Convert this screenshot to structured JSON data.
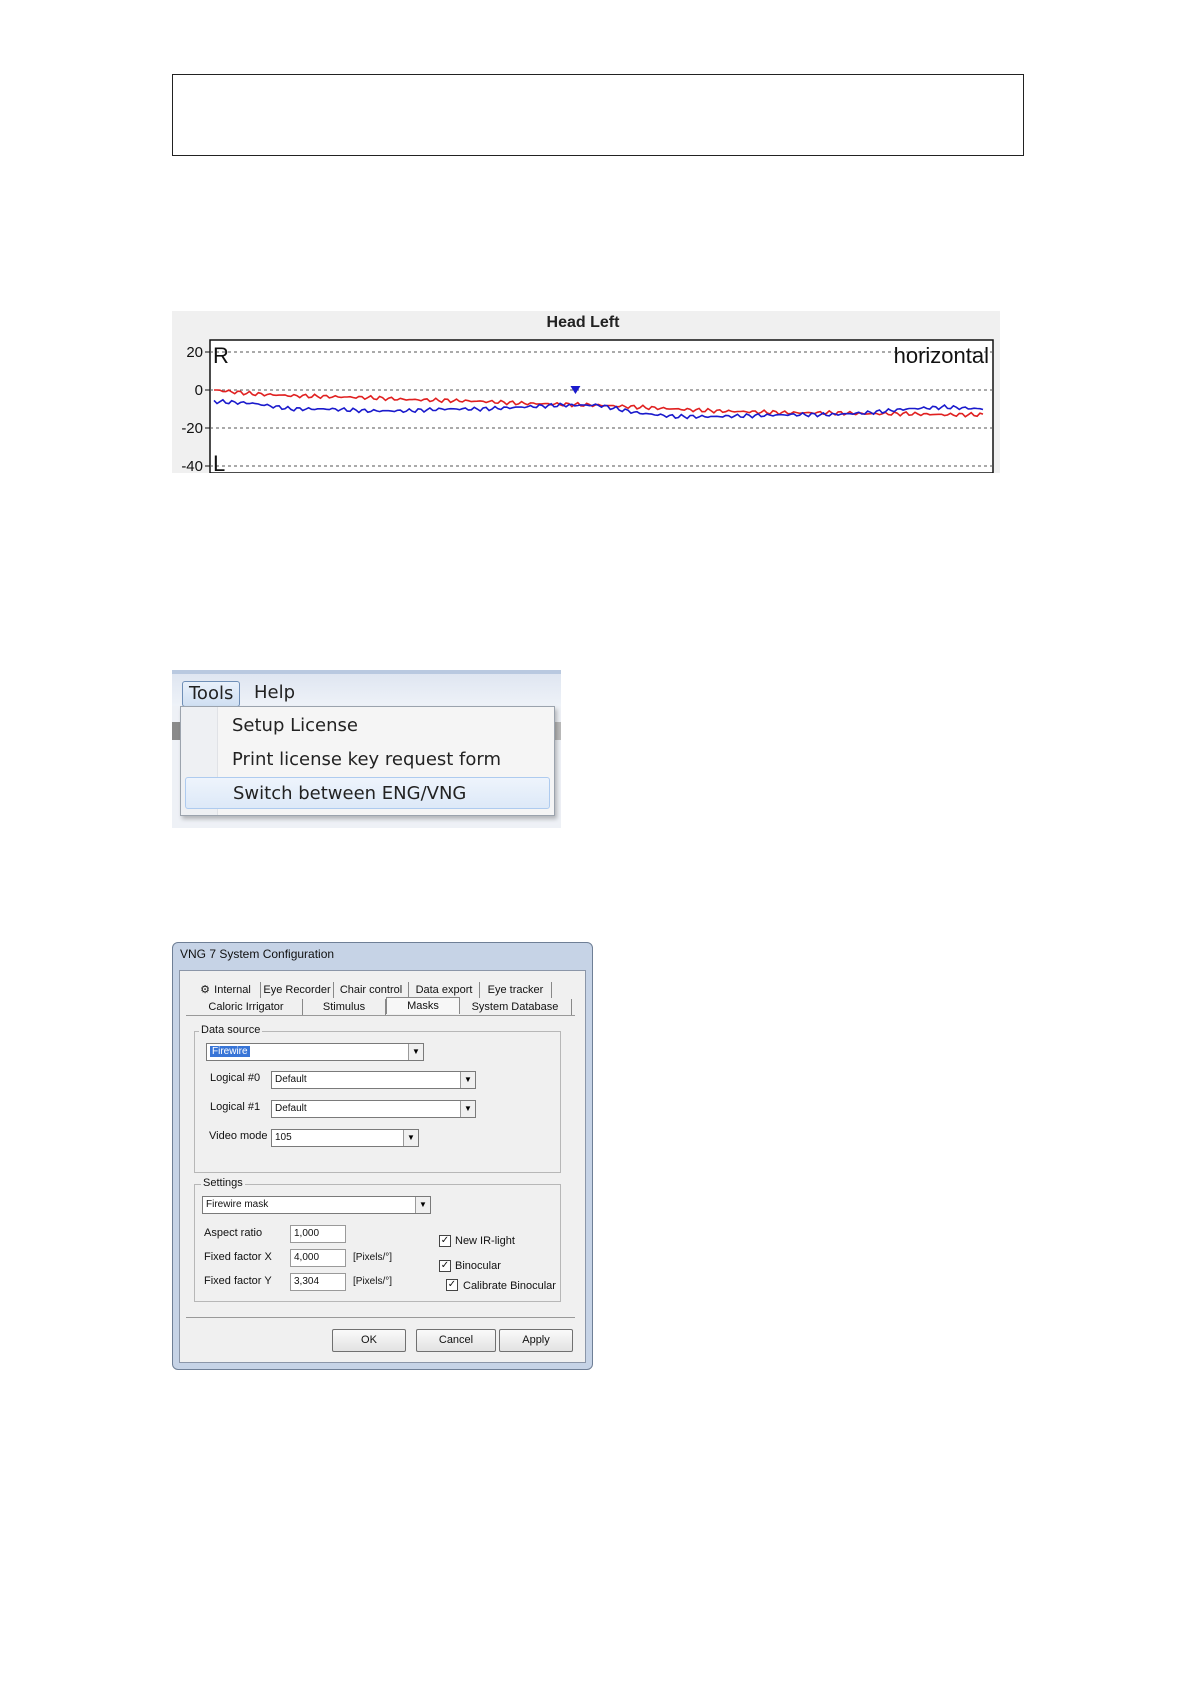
{
  "chart_data": {
    "type": "line",
    "title": "Head Left",
    "corner_labels": {
      "top_left": "R",
      "bottom_left": "L",
      "top_right": "horizontal"
    },
    "ylim": [
      -40,
      20
    ],
    "yticks": [
      "20",
      "0",
      "-20",
      "-40"
    ],
    "grid": "dashed horizontal lines at ticks",
    "xlabel": "",
    "ylabel": "",
    "marker": {
      "x": 0.47,
      "y": 0,
      "shape": "triangle-down",
      "color": "#1a1acc"
    },
    "series": [
      {
        "color": "#e02020",
        "x": [
          0,
          0.05,
          0.1,
          0.15,
          0.2,
          0.25,
          0.3,
          0.35,
          0.4,
          0.45,
          0.5,
          0.55,
          0.6,
          0.65,
          0.7,
          0.75,
          0.8,
          0.85,
          0.9,
          0.95,
          1.0
        ],
        "values": [
          0,
          -2,
          -3,
          -3.5,
          -4,
          -5,
          -5.5,
          -6,
          -7,
          -7.5,
          -8,
          -9,
          -10,
          -11,
          -11.5,
          -12,
          -12,
          -12.5,
          -12.5,
          -13,
          -13
        ]
      },
      {
        "color": "#1a1acc",
        "x": [
          0,
          0.05,
          0.1,
          0.15,
          0.2,
          0.25,
          0.3,
          0.35,
          0.4,
          0.45,
          0.5,
          0.55,
          0.6,
          0.65,
          0.7,
          0.75,
          0.8,
          0.85,
          0.9,
          0.95,
          1.0
        ],
        "values": [
          -6,
          -7,
          -10,
          -10,
          -11,
          -11,
          -10,
          -10,
          -9,
          -8,
          -8,
          -12,
          -14,
          -14,
          -13.5,
          -13,
          -13,
          -12,
          -10,
          -9,
          -10
        ]
      }
    ]
  },
  "menu": {
    "titles": [
      "Tools",
      "Help"
    ],
    "items": [
      "Setup License",
      "Print license key request form",
      "Switch between ENG/VNG"
    ]
  },
  "dialog": {
    "title": "VNG 7 System Configuration",
    "tabs_row1": [
      "Internal",
      "Eye Recorder",
      "Chair control",
      "Data export",
      "Eye tracker"
    ],
    "tabs_row2": [
      "Caloric Irrigator",
      "Stimulus",
      "Masks",
      "System Database"
    ],
    "data_source": {
      "group_label": "Data source",
      "source_value": "Firewire",
      "logical0_label": "Logical #0",
      "logical0_value": "Default",
      "logical1_label": "Logical #1",
      "logical1_value": "Default",
      "video_mode_label": "Video mode",
      "video_mode_value": "105"
    },
    "settings": {
      "group_label": "Settings",
      "mask_value": "Firewire mask",
      "aspect_ratio_label": "Aspect ratio",
      "aspect_ratio_value": "1,000",
      "fixed_x_label": "Fixed factor X",
      "fixed_x_value": "4,000",
      "fixed_x_unit": "[Pixels/°]",
      "fixed_y_label": "Fixed factor Y",
      "fixed_y_value": "3,304",
      "fixed_y_unit": "[Pixels/°]",
      "checkboxes": [
        "New IR-light",
        "Binocular",
        "Calibrate Binocular"
      ]
    },
    "buttons": [
      "OK",
      "Cancel",
      "Apply"
    ]
  }
}
